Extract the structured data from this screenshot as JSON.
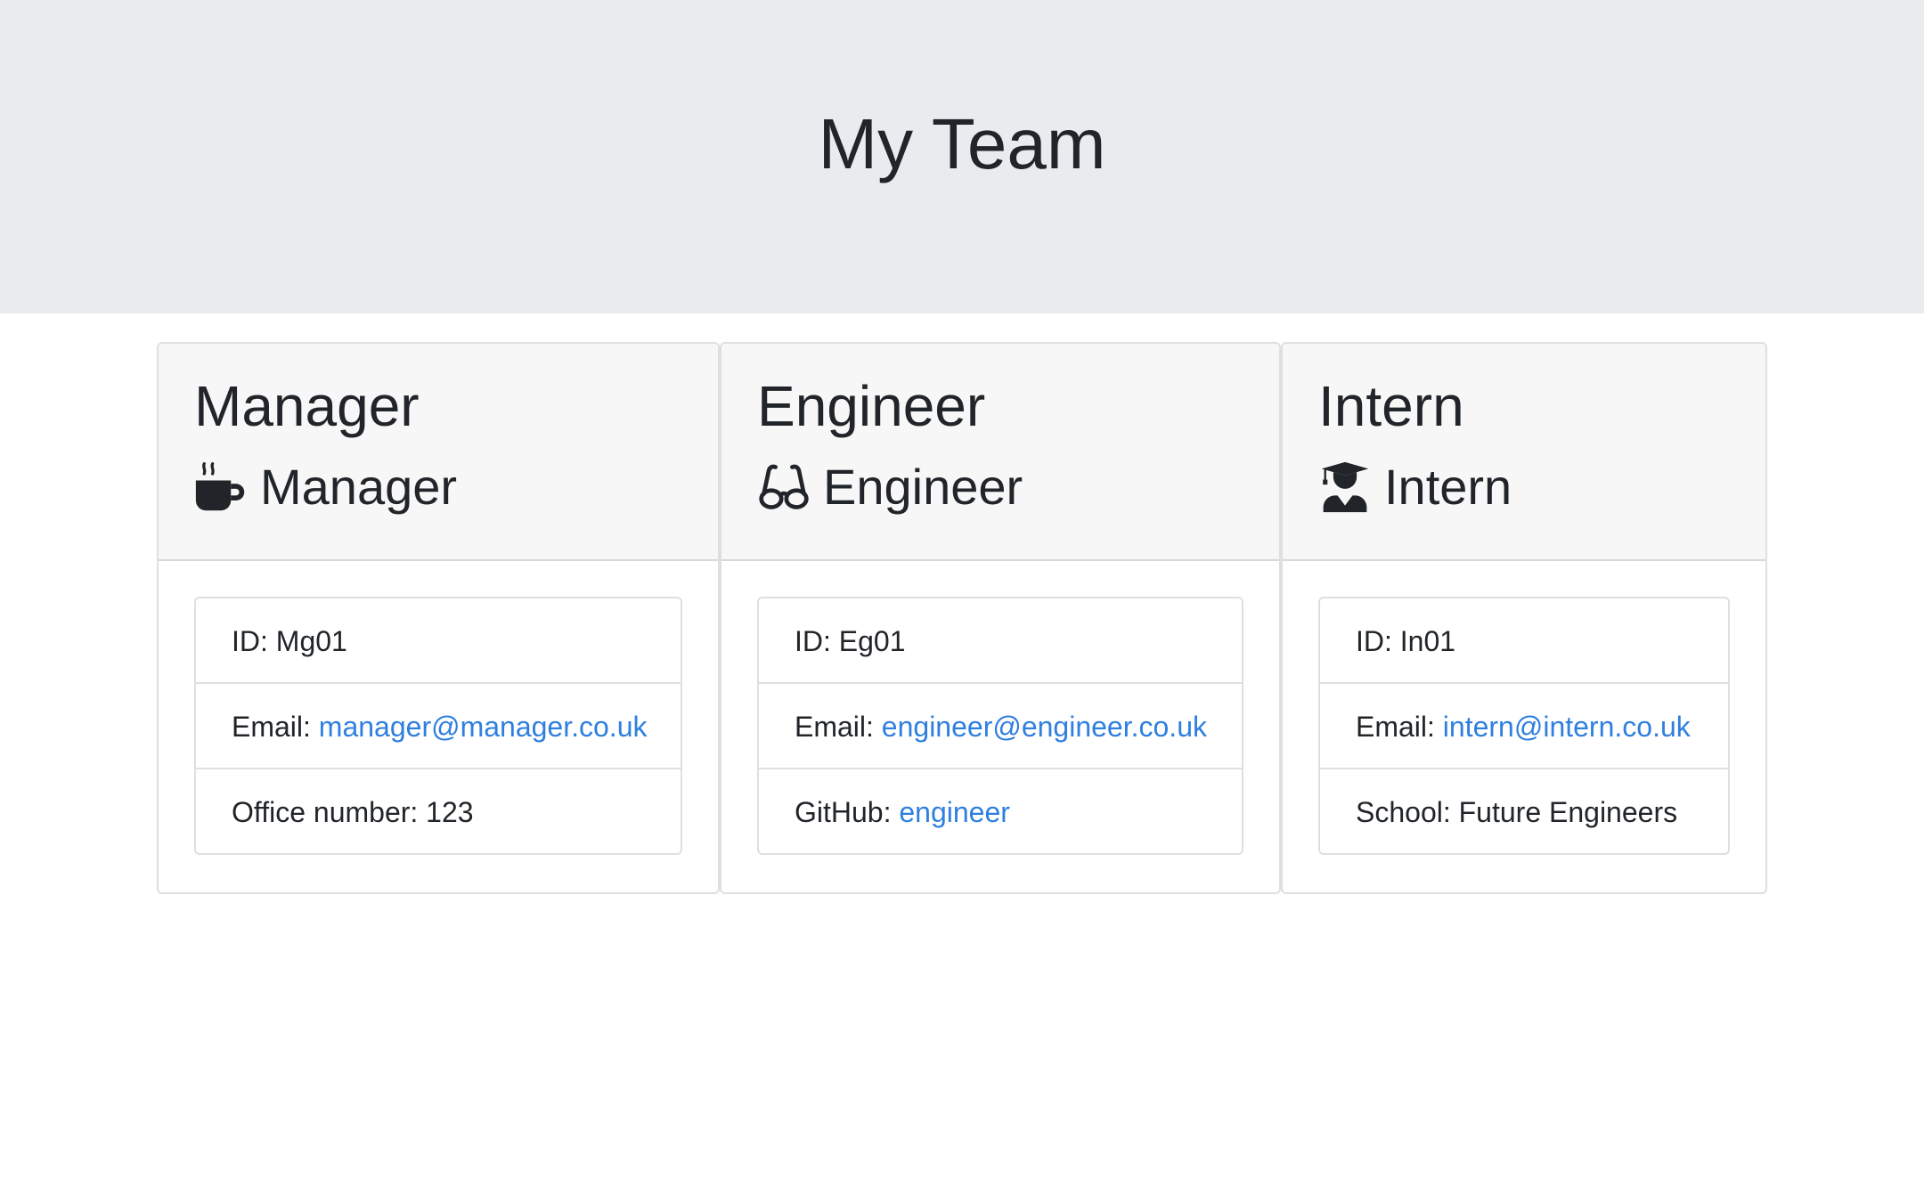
{
  "header": {
    "title": "My Team"
  },
  "colors": {
    "jumbotron_bg": "#e9ecef",
    "card_header_bg": "#f7f7f7",
    "link": "#2f7fe0",
    "text": "#212529"
  },
  "cards": [
    {
      "name": "Manager",
      "role": "Manager",
      "role_icon": "mug-hot-icon",
      "id_label": "ID: ",
      "id_value": "Mg01",
      "email_label": "Email: ",
      "email": "manager@manager.co.uk",
      "extra_label": "Office number: ",
      "extra_value": "123"
    },
    {
      "name": "Engineer",
      "role": "Engineer",
      "role_icon": "glasses-icon",
      "id_label": "ID: ",
      "id_value": "Eg01",
      "email_label": "Email: ",
      "email": "engineer@engineer.co.uk",
      "extra_label": "GitHub: ",
      "extra_value": "engineer"
    },
    {
      "name": "Intern",
      "role": "Intern",
      "role_icon": "user-graduate-icon",
      "id_label": "ID: ",
      "id_value": "In01",
      "email_label": "Email: ",
      "email": "intern@intern.co.uk",
      "extra_label": "School: ",
      "extra_value": "Future Engineers"
    }
  ]
}
